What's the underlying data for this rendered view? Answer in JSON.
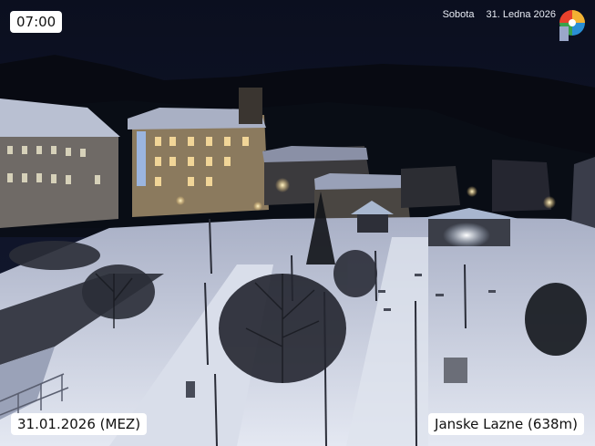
{
  "overlay": {
    "time": "07:00",
    "weekday": "Sobota",
    "date_long": "31. Ledna 2026",
    "date_short": "31.01.2026 (MEZ)",
    "location": "Janske Lazne (638m)"
  },
  "logo": {
    "icon": "webcam-logo-icon",
    "colors": [
      "#e8412c",
      "#f2b233",
      "#3aa24c",
      "#2a8fd4",
      "#9aa7c9"
    ]
  },
  "scene": {
    "sky": "#0d1224",
    "snow": "#c9cfe0",
    "lamp": "#ffd37a"
  }
}
